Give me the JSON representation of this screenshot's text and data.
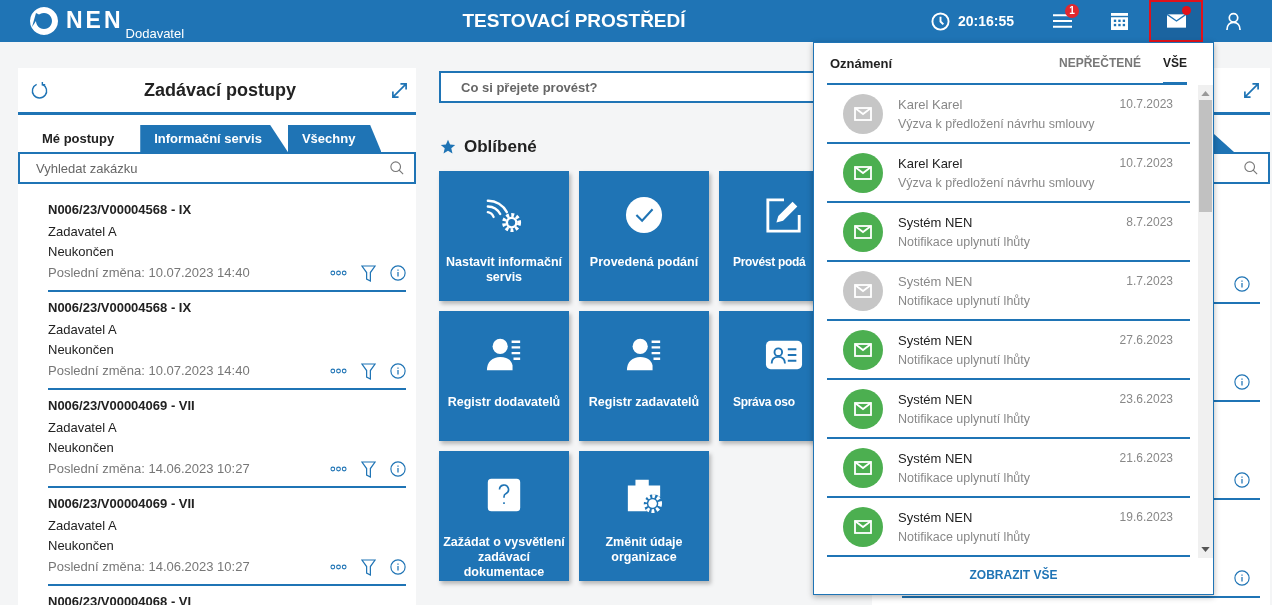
{
  "header": {
    "logo": "NEN",
    "role": "Dodavatel",
    "title": "TESTOVACÍ PROSTŘEDÍ",
    "time": "20:16:55",
    "menu_badge": "1",
    "mail_active": true,
    "mail_unread": true
  },
  "left_panel": {
    "title": "Zadávací postupy",
    "tabs": [
      {
        "label": "Mé postupy",
        "selected": true
      },
      {
        "label": "Informační servis",
        "selected": false
      },
      {
        "label": "Všechny",
        "selected": false
      }
    ],
    "search": {
      "placeholder": "Vyhledat zakázku"
    },
    "items": [
      {
        "title": "N006/23/V00004568 - IX",
        "authority": "Zadavatel A",
        "status": "Neukončen",
        "changed": "Poslední změna: 10.07.2023 14:40"
      },
      {
        "title": "N006/23/V00004568 - IX",
        "authority": "Zadavatel A",
        "status": "Neukončen",
        "changed": "Poslední změna: 10.07.2023 14:40"
      },
      {
        "title": "N006/23/V00004069 - VII",
        "authority": "Zadavatel A",
        "status": "Neukončen",
        "changed": "Poslední změna: 14.06.2023 10:27"
      },
      {
        "title": "N006/23/V00004069 - VII",
        "authority": "Zadavatel A",
        "status": "Neukončen",
        "changed": "Poslední změna: 14.06.2023 10:27"
      },
      {
        "title": "N006/23/V00004068 - VI"
      }
    ]
  },
  "main": {
    "search": {
      "placeholder": "Co si přejete provést?"
    },
    "favorites_title": "Oblíbené",
    "tiles": [
      {
        "label": "Nastavit informační servis"
      },
      {
        "label": "Provedená podání"
      },
      {
        "label": "Provést podá"
      },
      {
        "label": "Registr dodavatelů"
      },
      {
        "label": "Registr zadavatelů"
      },
      {
        "label": "Správa oso"
      },
      {
        "label": "Zažádat o vysvětlení zadávací dokumentace"
      },
      {
        "label": "Změnit údaje organizace"
      }
    ]
  },
  "notifications": {
    "title": "Oznámení",
    "tabs": [
      {
        "label": "NEPŘEČTENÉ",
        "selected": false
      },
      {
        "label": "VŠE",
        "selected": true
      }
    ],
    "items": [
      {
        "sender": "Karel Karel",
        "date": "10.7.2023",
        "subject": "Výzva k předložení návrhu smlouvy",
        "read": true
      },
      {
        "sender": "Karel Karel",
        "date": "10.7.2023",
        "subject": "Výzva k předložení návrhu smlouvy",
        "read": false
      },
      {
        "sender": "Systém NEN",
        "date": "8.7.2023",
        "subject": "Notifikace uplynutí lhůty",
        "read": false
      },
      {
        "sender": "Systém NEN",
        "date": "1.7.2023",
        "subject": "Notifikace uplynutí lhůty",
        "read": true
      },
      {
        "sender": "Systém NEN",
        "date": "27.6.2023",
        "subject": "Notifikace uplynutí lhůty",
        "read": false
      },
      {
        "sender": "Systém NEN",
        "date": "23.6.2023",
        "subject": "Notifikace uplynutí lhůty",
        "read": false
      },
      {
        "sender": "Systém NEN",
        "date": "21.6.2023",
        "subject": "Notifikace uplynutí lhůty",
        "read": false
      },
      {
        "sender": "Systém NEN",
        "date": "19.6.2023",
        "subject": "Notifikace uplynutí lhůty",
        "read": false
      }
    ],
    "show_all": "ZOBRAZIT VŠE"
  }
}
